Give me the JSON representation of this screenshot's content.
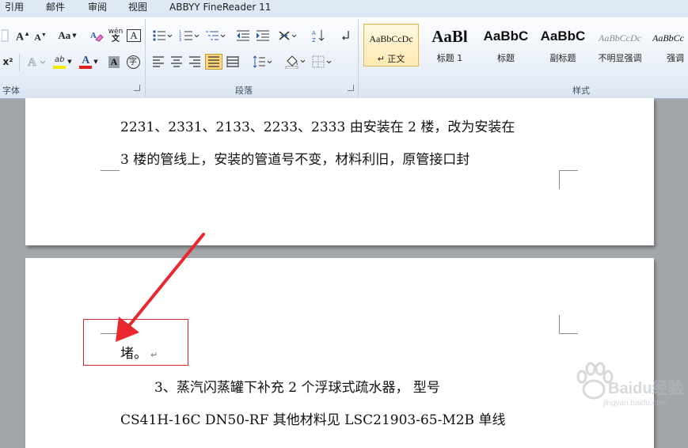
{
  "ribbon_tabs": [
    "引用",
    "邮件",
    "审阅",
    "视图",
    "ABBYY FineReader 11"
  ],
  "groups": {
    "font": "字体",
    "paragraph": "段落",
    "styles": "样式"
  },
  "font_buttons": {
    "grow": "A",
    "shrink": "A",
    "case": "Aa",
    "phonetic": "wén",
    "border_char": "A",
    "superscript": "x²",
    "highlight": "ab",
    "color": "A",
    "shade_char": "A",
    "enclose": "字"
  },
  "styles": [
    {
      "sample": "AaBbCcDc",
      "name": "正文",
      "mark": "↵",
      "active": true
    },
    {
      "sample": "AaBl",
      "name": "标题 1",
      "active": false
    },
    {
      "sample": "AaBbC",
      "name": "标题",
      "active": false
    },
    {
      "sample": "AaBbC",
      "name": "副标题",
      "active": false
    },
    {
      "sample": "AaBbCcDc",
      "name": "不明显强调",
      "active": false
    },
    {
      "sample": "AaBbCc",
      "name": "强调",
      "active": false
    }
  ],
  "colors": {
    "highlight_bar": "#f5e900",
    "font_color_bar": "#e02020",
    "arrow": "#e8282e",
    "box": "#e0242b",
    "selected_button": "#ffd97a"
  },
  "document": {
    "page1_lines": [
      "2231、2331、2133、2233、2333 由安装在 2 楼，改为安装在",
      "3  楼的管线上，安装的管道号不变，材料利旧，原管接口封"
    ],
    "page2_lines": [
      "堵。",
      "3、蒸汽闪蒸罐下补充  2  个浮球式疏水器，  型号",
      "CS41H-16C  DN50-RF  其他材料见  LSC21903-65-M2B  单线"
    ],
    "paragraph_mark": "↵"
  },
  "watermark": {
    "brand": "Baidu经验",
    "url": "jingyan.baidu.com"
  }
}
